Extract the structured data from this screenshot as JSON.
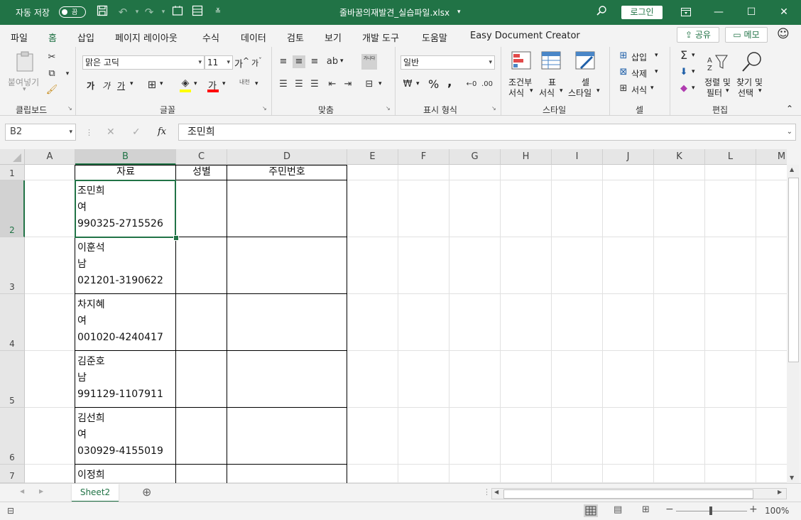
{
  "titlebar": {
    "autosave_label": "자동 저장",
    "autosave_state": "끔",
    "filename": "줄바꿈의재발견_실습파일.xlsx",
    "login_label": "로그인"
  },
  "menu": {
    "tabs": [
      "파일",
      "홈",
      "삽입",
      "페이지 레이아웃",
      "수식",
      "데이터",
      "검토",
      "보기",
      "개발 도구",
      "도움말",
      "Easy Document Creator"
    ],
    "active": "홈",
    "share_label": "공유",
    "memo_label": "메모"
  },
  "ribbon": {
    "clipboard": {
      "paste_label": "붙여넣기",
      "group_label": "클립보드"
    },
    "font": {
      "name": "맑은 고딕",
      "size": "11",
      "group_label": "글꼴",
      "bold": "가",
      "italic": "가",
      "underline": "가",
      "grow": "가",
      "shrink": "가",
      "fill_glyph": "가",
      "phonetic": "내천"
    },
    "alignment": {
      "group_label": "맞춤",
      "wrap_glyph": "가나다"
    },
    "number": {
      "format": "일반",
      "group_label": "표시 형식",
      "percent": "%",
      "comma": ","
    },
    "styles": {
      "conditional": [
        "조건부",
        "서식"
      ],
      "table": [
        "표",
        "서식"
      ],
      "cell": [
        "셀",
        "스타일"
      ],
      "group_label": "스타일"
    },
    "cells": {
      "insert": "삽입",
      "delete": "삭제",
      "format": "서식",
      "group_label": "셀"
    },
    "editing": {
      "sort": [
        "정렬 및",
        "필터"
      ],
      "find": [
        "찾기 및",
        "선택"
      ],
      "group_label": "편집"
    }
  },
  "formula_bar": {
    "name_box": "B2",
    "fx_label": "fx",
    "content": "조민희"
  },
  "sheet": {
    "columns": [
      "A",
      "B",
      "C",
      "D",
      "E",
      "F",
      "G",
      "H",
      "I",
      "J",
      "K",
      "L",
      "M"
    ],
    "selected_column": "B",
    "header_row": {
      "number": "1",
      "b": "자료",
      "c": "성별",
      "d": "주민번호"
    },
    "rows": [
      {
        "number": "2",
        "lines": [
          "조민희",
          "여",
          "990325-2715526"
        ]
      },
      {
        "number": "3",
        "lines": [
          "이훈석",
          "남",
          "021201-3190622"
        ]
      },
      {
        "number": "4",
        "lines": [
          "차지혜",
          "여",
          "001020-4240417"
        ]
      },
      {
        "number": "5",
        "lines": [
          "김준호",
          "남",
          "991129-1107911"
        ]
      },
      {
        "number": "6",
        "lines": [
          "김선희",
          "여",
          "030929-4155019"
        ]
      },
      {
        "number": "7",
        "lines": [
          "이정희"
        ]
      }
    ],
    "selected_row": "2",
    "selected_cell": "B2"
  },
  "sheet_tabs": {
    "tabs": [
      "Sheet2"
    ],
    "active": "Sheet2"
  },
  "status_bar": {
    "zoom": "100%"
  },
  "colors": {
    "accent": "#217346",
    "header_bg": "#e6e6e6",
    "grid_line": "#e1e1e1"
  }
}
